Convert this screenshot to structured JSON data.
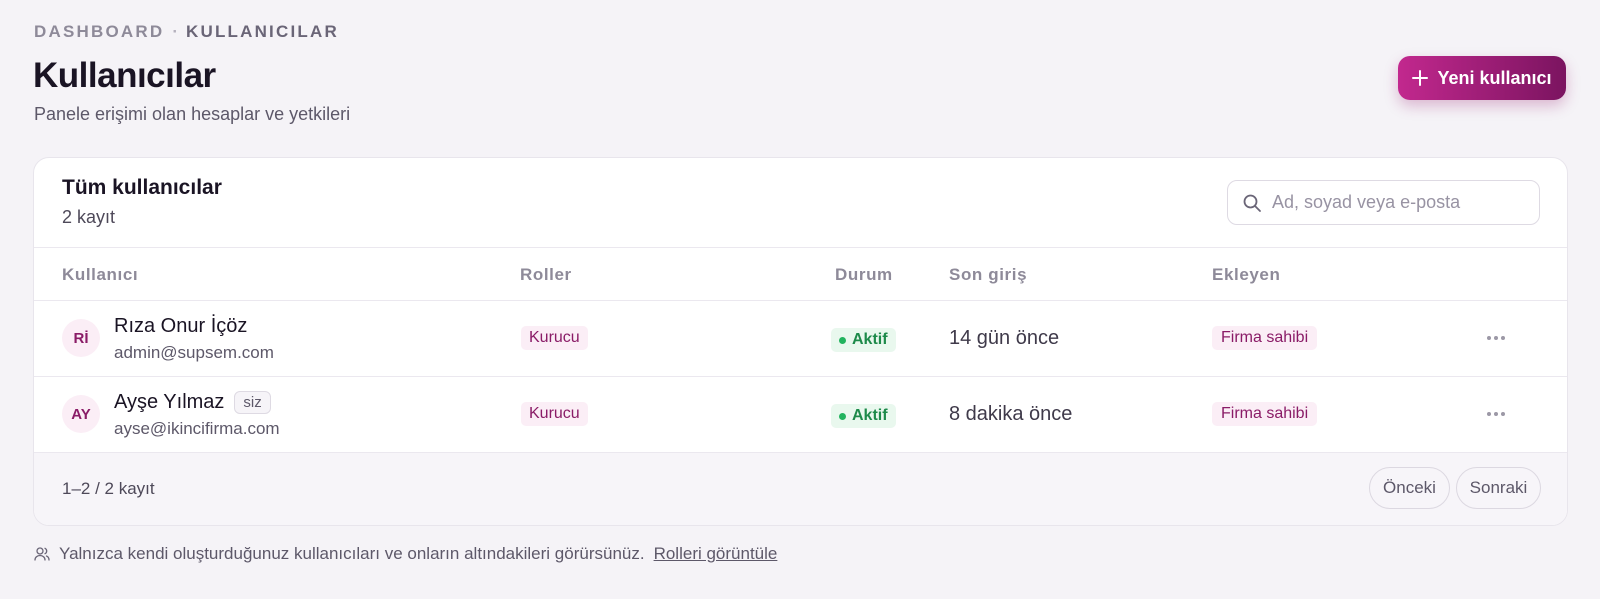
{
  "breadcrumb": {
    "root": "DASHBOARD",
    "separator": "·",
    "current": "KULLANICILAR"
  },
  "header": {
    "title": "Kullanıcılar",
    "subtitle": "Panele erişimi olan hesaplar ve yetkileri",
    "new_user_label": "Yeni kullanıcı"
  },
  "card": {
    "title": "Tüm kullanıcılar",
    "count": "2 kayıt",
    "search_placeholder": "Ad, soyad veya e-posta"
  },
  "columns": {
    "user": "Kullanıcı",
    "roles": "Roller",
    "status": "Durum",
    "last_login": "Son giriş",
    "added_by": "Ekleyen"
  },
  "rows": [
    {
      "initials": "Rİ",
      "name": "Rıza Onur İçöz",
      "badge": "",
      "email": "admin@supsem.com",
      "role": "Kurucu",
      "status": "Aktif",
      "last_login": "14 gün önce",
      "added_by": "Firma sahibi"
    },
    {
      "initials": "AY",
      "name": "Ayşe Yılmaz",
      "badge": "siz",
      "email": "ayse@ikincifirma.com",
      "role": "Kurucu",
      "status": "Aktif",
      "last_login": "8 dakika önce",
      "added_by": "Firma sahibi"
    }
  ],
  "pagination": {
    "info": "1–2 / 2 kayıt",
    "prev_label": "Önceki",
    "next_label": "Sonraki"
  },
  "footer": {
    "note": "Yalnızca kendi oluşturduğunuz kullanıcıları ve onların altındakileri görürsünüz.",
    "link_label": "Rolleri görüntüle"
  },
  "colors": {
    "accent_start": "#c2288e",
    "accent_end": "#7b1460",
    "status_active": "#1d8a4a",
    "background": "#f5f3f7"
  },
  "icons": {
    "new_user": "plus-icon",
    "search": "search-icon",
    "row_actions": "more-horizontal-icon",
    "footer_note": "users-icon"
  }
}
